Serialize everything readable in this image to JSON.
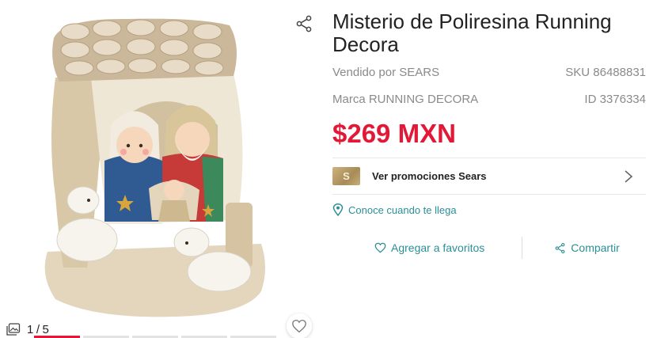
{
  "product": {
    "title": "Misterio de Poliresina Running Decora",
    "seller": "Vendido por SEARS",
    "sku": "SKU 86488831",
    "brand": "Marca RUNNING DECORA",
    "id": "ID 3376334",
    "price": "$269 MXN"
  },
  "gallery": {
    "current": "1",
    "separator": "/",
    "total": "5",
    "active_index": 0,
    "slides": 5
  },
  "promo": {
    "logo_text": "S",
    "label": "Ver promociones Sears"
  },
  "delivery": {
    "label": "Conoce cuando te llega"
  },
  "actions": {
    "favorite_label": "Agregar a favoritos",
    "share_label": "Compartir"
  },
  "icons": {
    "share_top": "share-icon",
    "gallery": "gallery-icon",
    "heart": "heart-icon",
    "location": "location-pin-icon",
    "chevron": "chevron-right-icon"
  },
  "colors": {
    "price": "#e31837",
    "accent": "#2a8f99",
    "active_dot": "#e31837"
  }
}
